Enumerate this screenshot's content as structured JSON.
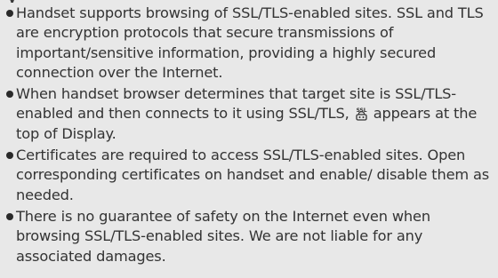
{
  "section": {
    "heading_fragment": "y"
  },
  "bullets": [
    {
      "text": "Handset supports browsing of SSL/TLS-enabled sites. SSL and TLS are encryption protocols that secure transmissions of important/sensitive information, providing a highly secured connection over the Internet."
    },
    {
      "text_before_icon": "When handset browser determines that target site is SSL/TLS-enabled and then connects to it using SSL/TLS,",
      "icon": "ssl-lock-icon",
      "icon_label": "SSL",
      "text_after_icon": "appears at the top of Display."
    },
    {
      "text": "Certificates are required to access SSL/TLS-enabled sites. Open corresponding certificates on handset and enable/ disable them as needed."
    },
    {
      "text": "There is no guarantee of safety on the Internet even when browsing SSL/TLS-enabled sites. We are not liable for any associated damages."
    }
  ],
  "colors": {
    "background": "#e8e8e8",
    "text": "#333333",
    "bullet": "#2a2a2a"
  }
}
